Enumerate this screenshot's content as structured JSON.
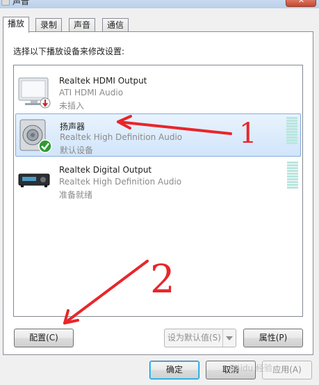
{
  "window": {
    "title": "声音"
  },
  "tabs": [
    {
      "label": "播放"
    },
    {
      "label": "录制"
    },
    {
      "label": "声音"
    },
    {
      "label": "通信"
    }
  ],
  "instruction": "选择以下播放设备来修改设置:",
  "devices": [
    {
      "name": "Realtek HDMI Output",
      "driver": "ATI HDMI Audio",
      "status": "未插入",
      "icon": "monitor-icon",
      "badge": "unplugged-arrow-icon",
      "selected": false
    },
    {
      "name": "扬声器",
      "driver": "Realtek High Definition Audio",
      "status": "默认设备",
      "icon": "speaker-icon",
      "badge": "default-check-icon",
      "selected": true
    },
    {
      "name": "Realtek Digital Output",
      "driver": "Realtek High Definition Audio",
      "status": "准备就绪",
      "icon": "digital-receiver-icon",
      "badge": "",
      "selected": false
    }
  ],
  "buttons": {
    "configure": "配置(C)",
    "set_default": "设为默认值(S)",
    "properties": "属性(P)",
    "ok": "确定",
    "cancel": "取消",
    "apply": "应用(A)"
  },
  "annotations": {
    "mark1": "1",
    "mark2": "2"
  },
  "watermark": "Baidu 经验",
  "colors": {
    "selection": "#d1e5fb",
    "annotation_red": "#e8262b",
    "check_green": "#2e9b33",
    "level_meter": "#b9e6df"
  }
}
